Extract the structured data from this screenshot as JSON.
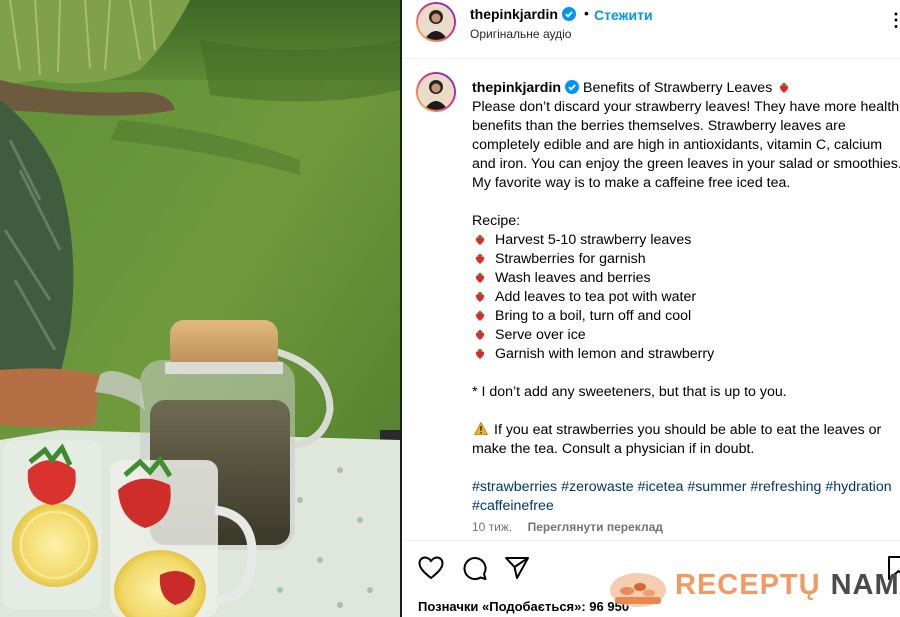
{
  "header": {
    "username": "thepinkjardin",
    "follow_label": "Стежити",
    "audio": "Оригінальне аудіо",
    "more_label": "⋮"
  },
  "caption": {
    "username": "thepinkjardin",
    "title": "Benefits of Strawberry Leaves",
    "intro": "Please don’t discard your strawberry leaves! They have more health benefits than the berries themselves. Strawberry leaves are completely edible and are high in antioxidants, vitamin C, calcium and iron. You can enjoy the green leaves in your salad or smoothies. My favorite way is to make a caffeine free iced tea.",
    "recipe_label": "Recipe:",
    "recipe": [
      "Harvest 5-10 strawberry leaves",
      "Strawberries for garnish",
      "Wash leaves and berries",
      "Add leaves to tea pot with water",
      "Bring to a boil, turn off and cool",
      "Serve over ice",
      "Garnish with lemon and strawberry"
    ],
    "note": "* I don’t add any sweeteners, but that is up to you.",
    "warning": "If you eat strawberries you should be able to eat the leaves or make the tea. Consult a physician if in doubt.",
    "hashtags": [
      "#strawberries",
      "#zerowaste",
      "#icetea",
      "#summer",
      "#refreshing",
      "#hydration",
      "#caffeinefree"
    ]
  },
  "meta": {
    "time_ago": "10 тиж.",
    "translate_label": "Переглянути переклад"
  },
  "likes": {
    "text": "Позначки «Подобається»: 96 950"
  },
  "watermark": {
    "text_orange": "RECEPTŲ",
    "text_dark": "NAMAI"
  },
  "colors": {
    "link_blue": "#0095f6",
    "hashtag_blue": "#00376b",
    "watermark_orange": "#f29a62"
  },
  "icons": [
    "verified-badge-icon",
    "heart-icon",
    "comment-icon",
    "share-icon",
    "bookmark-icon",
    "strawberry-icon",
    "warning-icon",
    "more-icon"
  ]
}
